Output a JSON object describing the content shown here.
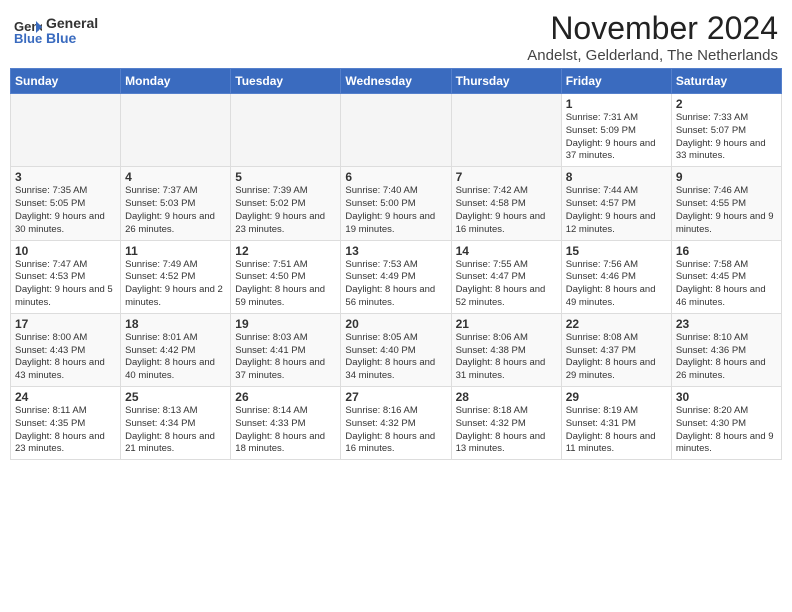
{
  "header": {
    "logo_line1": "General",
    "logo_line2": "Blue",
    "month_title": "November 2024",
    "location": "Andelst, Gelderland, The Netherlands"
  },
  "calendar": {
    "weekdays": [
      "Sunday",
      "Monday",
      "Tuesday",
      "Wednesday",
      "Thursday",
      "Friday",
      "Saturday"
    ],
    "weeks": [
      [
        {
          "day": "",
          "info": ""
        },
        {
          "day": "",
          "info": ""
        },
        {
          "day": "",
          "info": ""
        },
        {
          "day": "",
          "info": ""
        },
        {
          "day": "",
          "info": ""
        },
        {
          "day": "1",
          "info": "Sunrise: 7:31 AM\nSunset: 5:09 PM\nDaylight: 9 hours and 37 minutes."
        },
        {
          "day": "2",
          "info": "Sunrise: 7:33 AM\nSunset: 5:07 PM\nDaylight: 9 hours and 33 minutes."
        }
      ],
      [
        {
          "day": "3",
          "info": "Sunrise: 7:35 AM\nSunset: 5:05 PM\nDaylight: 9 hours and 30 minutes."
        },
        {
          "day": "4",
          "info": "Sunrise: 7:37 AM\nSunset: 5:03 PM\nDaylight: 9 hours and 26 minutes."
        },
        {
          "day": "5",
          "info": "Sunrise: 7:39 AM\nSunset: 5:02 PM\nDaylight: 9 hours and 23 minutes."
        },
        {
          "day": "6",
          "info": "Sunrise: 7:40 AM\nSunset: 5:00 PM\nDaylight: 9 hours and 19 minutes."
        },
        {
          "day": "7",
          "info": "Sunrise: 7:42 AM\nSunset: 4:58 PM\nDaylight: 9 hours and 16 minutes."
        },
        {
          "day": "8",
          "info": "Sunrise: 7:44 AM\nSunset: 4:57 PM\nDaylight: 9 hours and 12 minutes."
        },
        {
          "day": "9",
          "info": "Sunrise: 7:46 AM\nSunset: 4:55 PM\nDaylight: 9 hours and 9 minutes."
        }
      ],
      [
        {
          "day": "10",
          "info": "Sunrise: 7:47 AM\nSunset: 4:53 PM\nDaylight: 9 hours and 5 minutes."
        },
        {
          "day": "11",
          "info": "Sunrise: 7:49 AM\nSunset: 4:52 PM\nDaylight: 9 hours and 2 minutes."
        },
        {
          "day": "12",
          "info": "Sunrise: 7:51 AM\nSunset: 4:50 PM\nDaylight: 8 hours and 59 minutes."
        },
        {
          "day": "13",
          "info": "Sunrise: 7:53 AM\nSunset: 4:49 PM\nDaylight: 8 hours and 56 minutes."
        },
        {
          "day": "14",
          "info": "Sunrise: 7:55 AM\nSunset: 4:47 PM\nDaylight: 8 hours and 52 minutes."
        },
        {
          "day": "15",
          "info": "Sunrise: 7:56 AM\nSunset: 4:46 PM\nDaylight: 8 hours and 49 minutes."
        },
        {
          "day": "16",
          "info": "Sunrise: 7:58 AM\nSunset: 4:45 PM\nDaylight: 8 hours and 46 minutes."
        }
      ],
      [
        {
          "day": "17",
          "info": "Sunrise: 8:00 AM\nSunset: 4:43 PM\nDaylight: 8 hours and 43 minutes."
        },
        {
          "day": "18",
          "info": "Sunrise: 8:01 AM\nSunset: 4:42 PM\nDaylight: 8 hours and 40 minutes."
        },
        {
          "day": "19",
          "info": "Sunrise: 8:03 AM\nSunset: 4:41 PM\nDaylight: 8 hours and 37 minutes."
        },
        {
          "day": "20",
          "info": "Sunrise: 8:05 AM\nSunset: 4:40 PM\nDaylight: 8 hours and 34 minutes."
        },
        {
          "day": "21",
          "info": "Sunrise: 8:06 AM\nSunset: 4:38 PM\nDaylight: 8 hours and 31 minutes."
        },
        {
          "day": "22",
          "info": "Sunrise: 8:08 AM\nSunset: 4:37 PM\nDaylight: 8 hours and 29 minutes."
        },
        {
          "day": "23",
          "info": "Sunrise: 8:10 AM\nSunset: 4:36 PM\nDaylight: 8 hours and 26 minutes."
        }
      ],
      [
        {
          "day": "24",
          "info": "Sunrise: 8:11 AM\nSunset: 4:35 PM\nDaylight: 8 hours and 23 minutes."
        },
        {
          "day": "25",
          "info": "Sunrise: 8:13 AM\nSunset: 4:34 PM\nDaylight: 8 hours and 21 minutes."
        },
        {
          "day": "26",
          "info": "Sunrise: 8:14 AM\nSunset: 4:33 PM\nDaylight: 8 hours and 18 minutes."
        },
        {
          "day": "27",
          "info": "Sunrise: 8:16 AM\nSunset: 4:32 PM\nDaylight: 8 hours and 16 minutes."
        },
        {
          "day": "28",
          "info": "Sunrise: 8:18 AM\nSunset: 4:32 PM\nDaylight: 8 hours and 13 minutes."
        },
        {
          "day": "29",
          "info": "Sunrise: 8:19 AM\nSunset: 4:31 PM\nDaylight: 8 hours and 11 minutes."
        },
        {
          "day": "30",
          "info": "Sunrise: 8:20 AM\nSunset: 4:30 PM\nDaylight: 8 hours and 9 minutes."
        }
      ]
    ]
  }
}
